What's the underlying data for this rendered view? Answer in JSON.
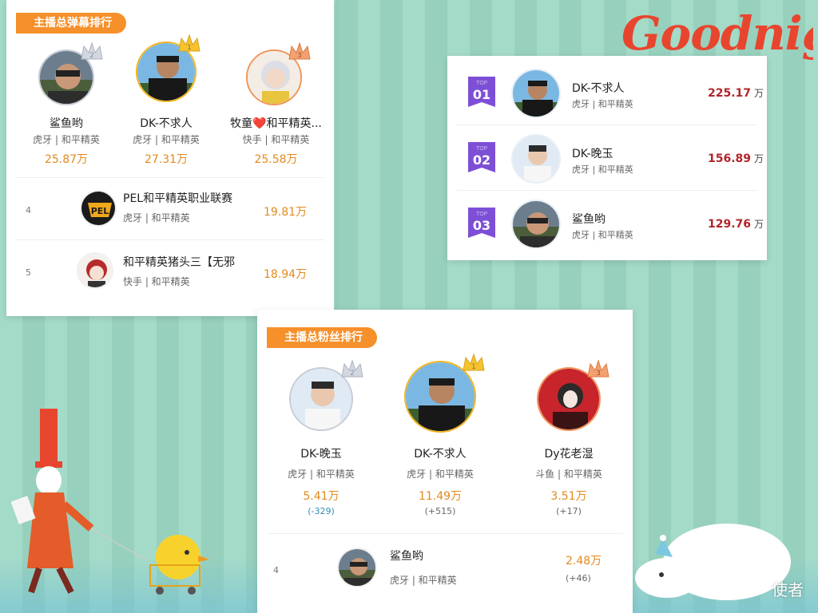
{
  "decor": {
    "goodnight_text": "Goodnight",
    "watermark": "使者"
  },
  "danmu_card": {
    "tag": "主播总弹幕排行",
    "top3": [
      {
        "name": "鲨鱼哟",
        "platform": "虎牙 | 和平精英",
        "value": "25.87万",
        "crown": "silver",
        "avatar": "avatar-shayu"
      },
      {
        "name": "DK-不求人",
        "platform": "虎牙 | 和平精英",
        "value": "27.31万",
        "crown": "gold",
        "avatar": "avatar-dk"
      },
      {
        "name": "牧童❤️和平精英...",
        "platform": "快手 | 和平精英",
        "value": "25.58万",
        "crown": "bronze",
        "avatar": "avatar-mutong"
      }
    ],
    "rows": [
      {
        "rank": "4",
        "name": "PEL和平精英职业联赛",
        "platform": "虎牙 | 和平精英",
        "value": "19.81万"
      },
      {
        "rank": "5",
        "name": "和平精英猪头三【无邪",
        "platform": "快手 | 和平精英",
        "value": "18.94万"
      }
    ]
  },
  "top_card": {
    "rows": [
      {
        "rank": "01",
        "name": "DK-不求人",
        "platform": "虎牙 | 和平精英",
        "value": "225.17",
        "unit": "万"
      },
      {
        "rank": "02",
        "name": "DK-晚玉",
        "platform": "虎牙 | 和平精英",
        "value": "156.89",
        "unit": "万"
      },
      {
        "rank": "03",
        "name": "鲨鱼哟",
        "platform": "虎牙 | 和平精英",
        "value": "129.76",
        "unit": "万"
      }
    ]
  },
  "fans_card": {
    "tag": "主播总粉丝排行",
    "top3": [
      {
        "name": "DK-晚玉",
        "platform": "虎牙 | 和平精英",
        "value": "5.41万",
        "delta": "(-329)",
        "crown": "silver"
      },
      {
        "name": "DK-不求人",
        "platform": "虎牙 | 和平精英",
        "value": "11.49万",
        "delta": "(+515)",
        "crown": "gold"
      },
      {
        "name": "Dy花老湿",
        "platform": "斗鱼 | 和平精英",
        "value": "3.51万",
        "delta": "(+17)",
        "crown": "bronze"
      }
    ],
    "rows": [
      {
        "rank": "4",
        "name": "鲨鱼哟",
        "platform": "虎牙 | 和平精英",
        "value": "2.48万",
        "delta": "(+46)"
      }
    ]
  },
  "colors": {
    "tag": "#f6902a",
    "value_orange": "#e28a1d",
    "top_red": "#b2242a",
    "ribbon_purple": "#7d4fd6"
  }
}
